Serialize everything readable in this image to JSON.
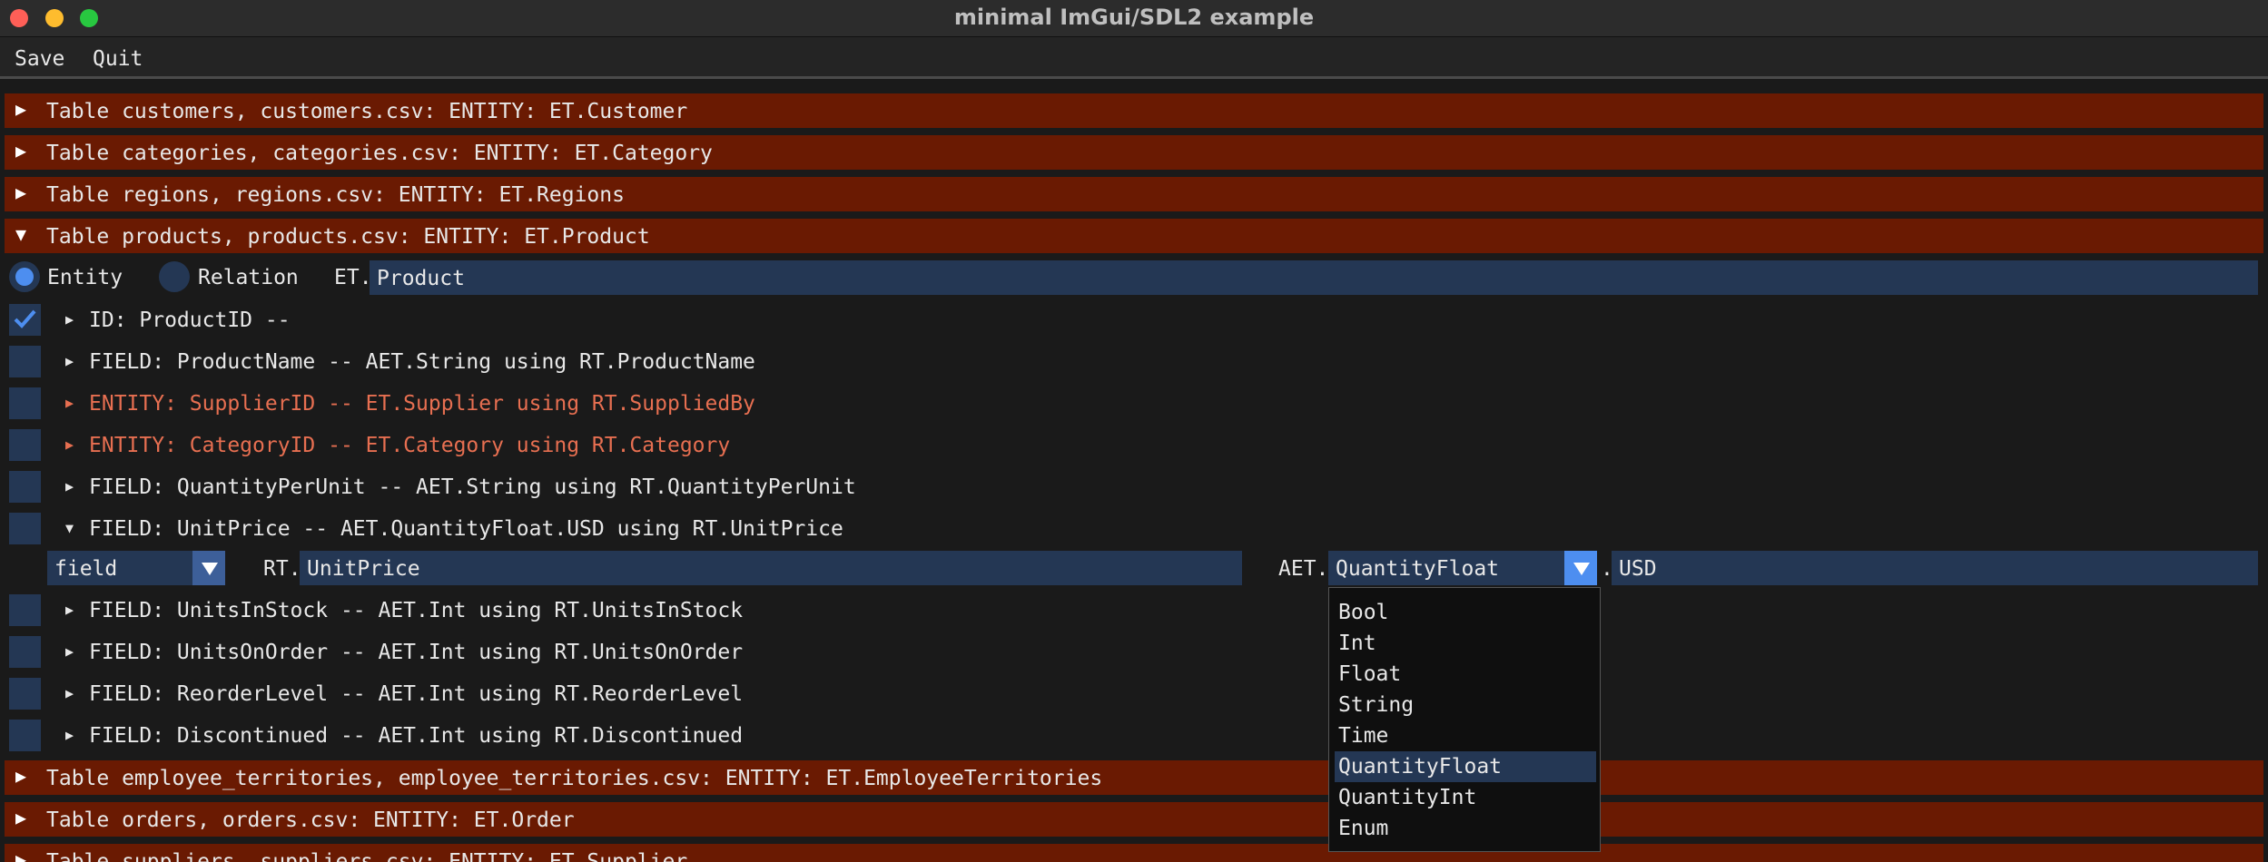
{
  "window": {
    "title": "minimal ImGui/SDL2 example"
  },
  "menu": {
    "save": "Save",
    "quit": "Quit"
  },
  "tables_before": [
    "Table customers, customers.csv: ENTITY: ET.Customer",
    "Table categories, categories.csv: ENTITY: ET.Category",
    "Table regions, regions.csv: ENTITY: ET.Regions",
    "Table products, products.csv: ENTITY: ET.Product"
  ],
  "product": {
    "entity_label": "Entity",
    "relation_label": "Relation",
    "type_prefix": "ET.",
    "type_value": "Product",
    "selected_kind": "Entity",
    "fields": [
      {
        "text": "ID: ProductID --",
        "checked": true,
        "kind": "id",
        "expanded": false
      },
      {
        "text": "FIELD: ProductName -- AET.String using RT.ProductName",
        "checked": false,
        "kind": "field",
        "expanded": false
      },
      {
        "text": "ENTITY: SupplierID -- ET.Supplier using RT.SuppliedBy",
        "checked": false,
        "kind": "entity",
        "expanded": false
      },
      {
        "text": "ENTITY: CategoryID -- ET.Category using RT.Category",
        "checked": false,
        "kind": "entity",
        "expanded": false
      },
      {
        "text": "FIELD: QuantityPerUnit -- AET.String using RT.QuantityPerUnit",
        "checked": false,
        "kind": "field",
        "expanded": false
      },
      {
        "text": "FIELD: UnitPrice -- AET.QuantityFloat.USD using RT.UnitPrice",
        "checked": false,
        "kind": "field",
        "expanded": true
      }
    ],
    "editor": {
      "kind_value": "field",
      "rt_prefix": "RT.",
      "rt_value": "UnitPrice",
      "aet_prefix": "AET.",
      "aet_value": "QuantityFloat",
      "dot": ".",
      "unit_value": "USD"
    },
    "fields_after": [
      "FIELD: UnitsInStock -- AET.Int using RT.UnitsInStock",
      "FIELD: UnitsOnOrder -- AET.Int using RT.UnitsOnOrder",
      "FIELD: ReorderLevel -- AET.Int using RT.ReorderLevel",
      "FIELD: Discontinued -- AET.Int using RT.Discontinued"
    ]
  },
  "aet_options": [
    "Bool",
    "Int",
    "Float",
    "String",
    "Time",
    "QuantityFloat",
    "QuantityInt",
    "Enum"
  ],
  "aet_selected": "QuantityFloat",
  "tables_after": [
    "Table employee_territories, employee_territories.csv: ENTITY: ET.EmployeeTerritories",
    "Table orders, orders.csv: ENTITY: ET.Order",
    "Table suppliers, suppliers.csv: ENTITY: ET.Supplier"
  ],
  "colors": {
    "header_bg": "#6a1a02",
    "frame_bg": "#243754",
    "accent": "#4d8ef0",
    "entity_text": "#e76f51"
  }
}
